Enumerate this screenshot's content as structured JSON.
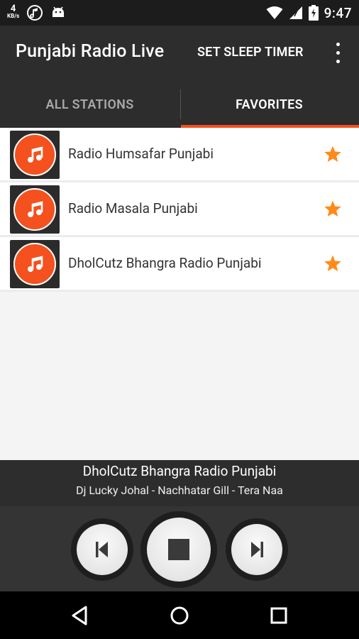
{
  "status_bar": {
    "net_speed_value": "4",
    "net_speed_unit": "KB/s",
    "time": "9:47"
  },
  "app_bar": {
    "title": "Punjabi Radio Live",
    "sleep_timer_label": "SET SLEEP TIMER"
  },
  "tabs": [
    {
      "label": "ALL STATIONS",
      "selected": false
    },
    {
      "label": "FAVORITES",
      "selected": true
    }
  ],
  "stations": [
    {
      "name": "Radio Humsafar Punjabi",
      "favorite": true,
      "icon": "music-note-icon"
    },
    {
      "name": "Radio Masala Punjabi",
      "favorite": true,
      "icon": "music-note-icon"
    },
    {
      "name": "DholCutz Bhangra Radio Punjabi",
      "favorite": true,
      "icon": "music-note-icon"
    }
  ],
  "now_playing": {
    "station": "DholCutz Bhangra Radio Punjabi",
    "track": "Dj Lucky Johal - Nachhatar Gill - Tera Naa"
  },
  "colors": {
    "accent": "#f4511e",
    "star": "#ff8a1a",
    "app_bar": "#2d2d2d"
  }
}
